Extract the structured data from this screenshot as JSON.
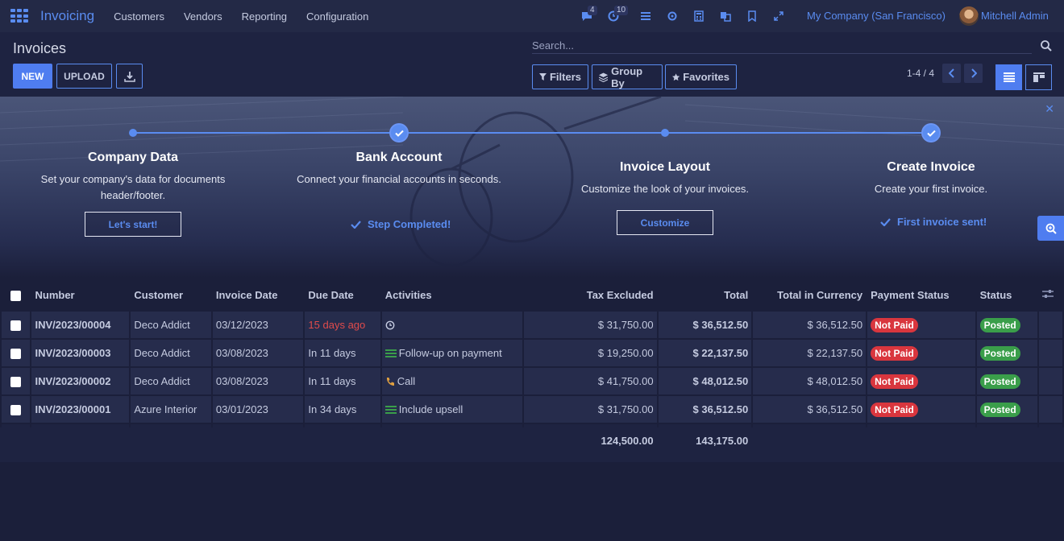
{
  "topbar": {
    "app_name": "Invoicing",
    "menu": [
      "Customers",
      "Vendors",
      "Reporting",
      "Configuration"
    ],
    "chat_count": "4",
    "activity_count": "10",
    "company": "My Company (San Francisco)",
    "user": "Mitchell Admin"
  },
  "control_panel": {
    "title": "Invoices",
    "new_label": "NEW",
    "upload_label": "UPLOAD",
    "search_placeholder": "Search...",
    "filters_label": "Filters",
    "groupby_label": "Group By",
    "favorites_label": "Favorites",
    "pager": "1-4 / 4"
  },
  "onboarding": {
    "steps": [
      {
        "title": "Company Data",
        "desc": "Set your company's data for documents header/footer.",
        "action": "Let's start!",
        "done": false
      },
      {
        "title": "Bank Account",
        "desc": "Connect your financial accounts in seconds.",
        "action": "Step Completed!",
        "done": true
      },
      {
        "title": "Invoice Layout",
        "desc": "Customize the look of your invoices.",
        "action": "Customize",
        "done": false
      },
      {
        "title": "Create Invoice",
        "desc": "Create your first invoice.",
        "action": "First invoice sent!",
        "done": true
      }
    ]
  },
  "table": {
    "columns": [
      "Number",
      "Customer",
      "Invoice Date",
      "Due Date",
      "Activities",
      "Tax Excluded",
      "Total",
      "Total in Currency",
      "Payment Status",
      "Status"
    ],
    "rows": [
      {
        "number": "INV/2023/00004",
        "customer": "Deco Addict",
        "invoice_date": "03/12/2023",
        "due_date": "15 days ago",
        "due_overdue": true,
        "activity_icon": "clock-icon",
        "activity": "",
        "tax_excluded": "$ 31,750.00",
        "total": "$ 36,512.50",
        "total_currency": "$ 36,512.50",
        "payment_status": "Not Paid",
        "status": "Posted"
      },
      {
        "number": "INV/2023/00003",
        "customer": "Deco Addict",
        "invoice_date": "03/08/2023",
        "due_date": "In 11 days",
        "due_overdue": false,
        "activity_icon": "list-icon",
        "activity": "Follow-up on payment",
        "tax_excluded": "$ 19,250.00",
        "total": "$ 22,137.50",
        "total_currency": "$ 22,137.50",
        "payment_status": "Not Paid",
        "status": "Posted"
      },
      {
        "number": "INV/2023/00002",
        "customer": "Deco Addict",
        "invoice_date": "03/08/2023",
        "due_date": "In 11 days",
        "due_overdue": false,
        "activity_icon": "phone-icon",
        "activity": "Call",
        "tax_excluded": "$ 41,750.00",
        "total": "$ 48,012.50",
        "total_currency": "$ 48,012.50",
        "payment_status": "Not Paid",
        "status": "Posted"
      },
      {
        "number": "INV/2023/00001",
        "customer": "Azure Interior",
        "invoice_date": "03/01/2023",
        "due_date": "In 34 days",
        "due_overdue": false,
        "activity_icon": "list-icon",
        "activity": "Include upsell",
        "tax_excluded": "$ 31,750.00",
        "total": "$ 36,512.50",
        "total_currency": "$ 36,512.50",
        "payment_status": "Not Paid",
        "status": "Posted"
      }
    ],
    "totals": {
      "tax_excluded": "124,500.00",
      "total": "143,175.00"
    }
  }
}
